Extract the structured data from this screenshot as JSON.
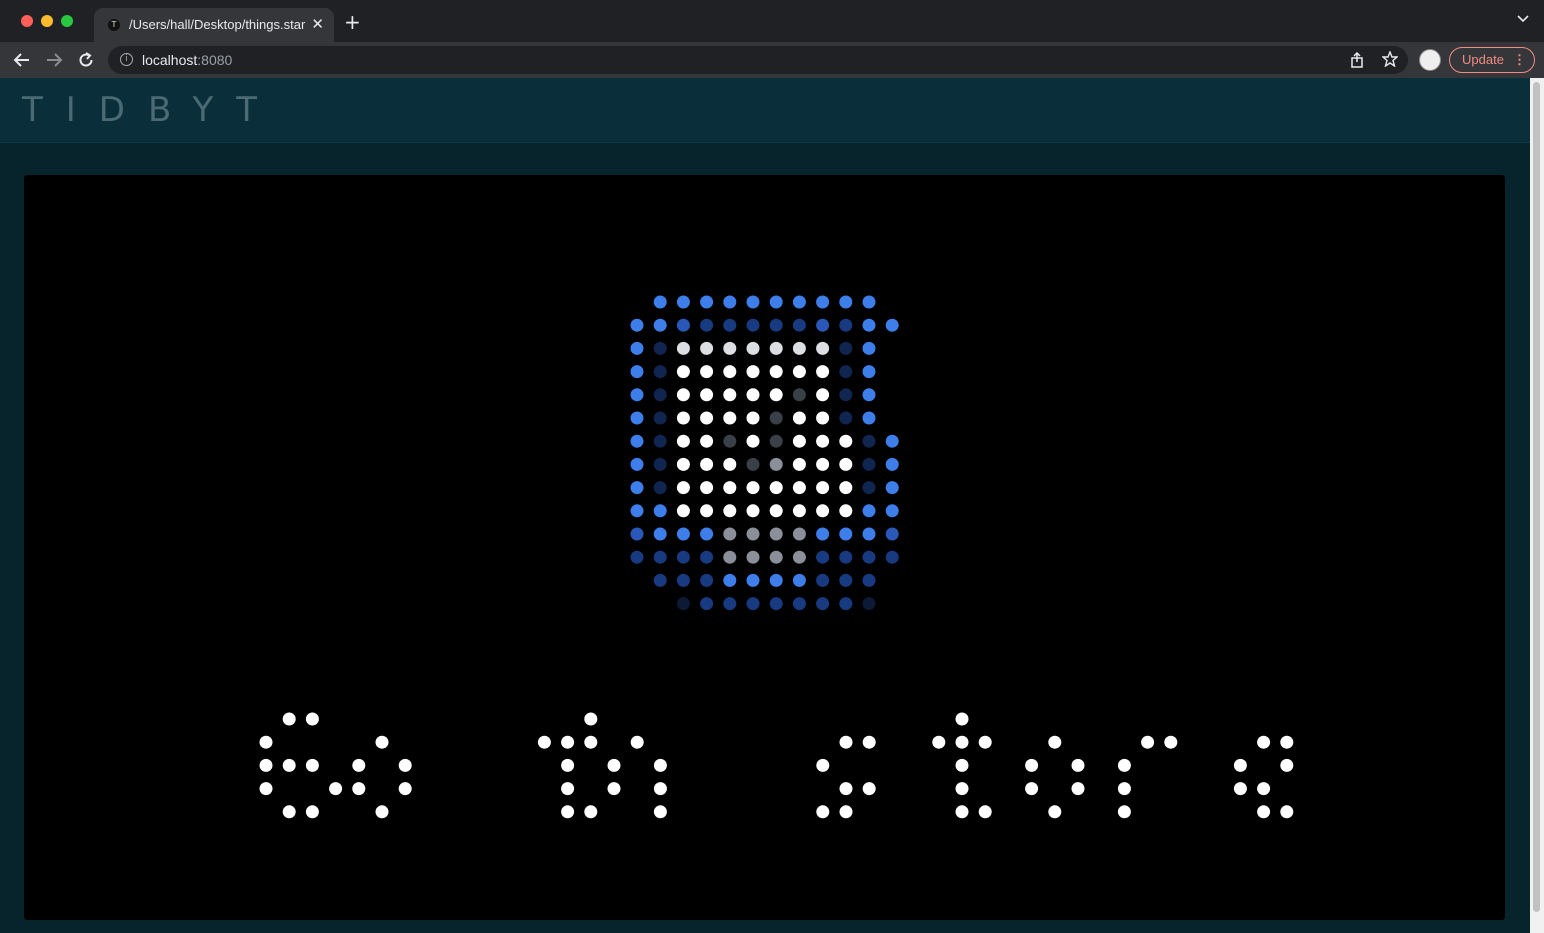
{
  "browser": {
    "tab_title": "/Users/hall/Desktop/things.star",
    "tab_favicon": "T",
    "url_host": "localhost",
    "url_port": ":8080",
    "update_label": "Update",
    "icons": [
      "back-arrow-icon",
      "forward-arrow-icon",
      "reload-icon",
      "info-icon",
      "share-icon",
      "star-icon",
      "profile-avatar",
      "close-icon",
      "plus-icon",
      "chevron-down-icon",
      "kebab-menu-icon"
    ]
  },
  "site": {
    "logo": "TIDBYT"
  },
  "display": {
    "text": "Go to store",
    "colors": {
      "white": "#ffffff",
      "blue": "#3d7eea",
      "blue_mid": "#2a58b8",
      "blue_dark": "#183a80",
      "navy": "#102550",
      "navy_deep": "#0c1a36",
      "gray": "#8a8f99",
      "gray_dark": "#3a4048",
      "light_gray": "#dcdee4"
    },
    "icon_legend": {
      "B": "blue",
      "M": "blue_mid",
      "D": "blue_dark",
      "N": "navy",
      "X": "navy_deep",
      "W": "white",
      "L": "light_gray",
      "G": "gray",
      "K": "gray_dark"
    },
    "icon_rows": [
      ".BBBBBBBBBB.",
      "BBMDDDDDMDBB",
      "BNLLLLLLLNB.",
      "BNWWWWWWWNB.",
      "BNWWWWWKWNB.",
      "BNWWWWKWWNB.",
      "BNWWKWKWWWNB",
      "BNWWWKGWWWNB",
      "BNWWWWWWWWNB",
      "BBWWWWWWWWBB",
      "MBBBGGGGBBBM",
      "DDDDGGGGDDDD",
      ".DDDBBBBDDD.",
      "..XDDDDDDDX."
    ],
    "text_rows": [
      ".XX...........X...............X...................",
      "X....X......XXX.X........XX..XXX..X...XX...XX.....",
      "XXX.X.X......X.X.X......X.....X..X.X.X....X.X.....",
      "X..XX.X......X.X.X.......XX...X..X.X.X....XX......",
      ".XX..X.......XX..X......XX....XX..X..X.....XX....."
    ]
  }
}
